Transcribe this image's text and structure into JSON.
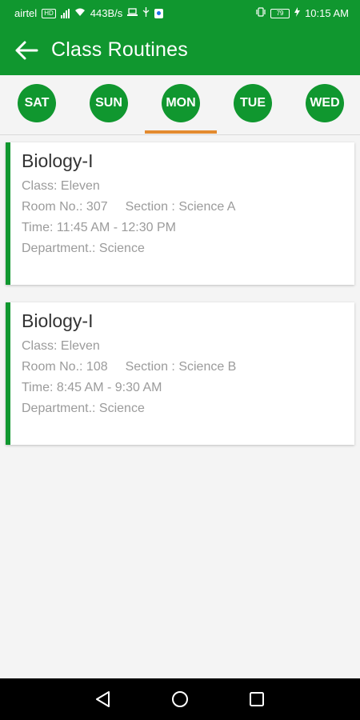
{
  "status_bar": {
    "carrier": "airtel",
    "carrier_badge": "HD",
    "speed": "443B/s",
    "battery_level": "79",
    "time": "10:15 AM"
  },
  "app_bar": {
    "title": "Class Routines"
  },
  "days": [
    {
      "label": "SAT",
      "selected": false
    },
    {
      "label": "SUN",
      "selected": false
    },
    {
      "label": "MON",
      "selected": true
    },
    {
      "label": "TUE",
      "selected": false
    },
    {
      "label": "WED",
      "selected": false
    }
  ],
  "routines": [
    {
      "subject": "Biology-I",
      "class": "Class: Eleven",
      "room": "Room No.: 307",
      "section": "Section : Science A",
      "time": "Time: 11:45 AM - 12:30 PM",
      "department": "Department.: Science"
    },
    {
      "subject": "Biology-I",
      "class": "Class: Eleven",
      "room": "Room No.: 108",
      "section": "Section : Science B",
      "time": "Time: 8:45 AM - 9:30 AM",
      "department": "Department.: Science"
    }
  ],
  "colors": {
    "primary": "#10972f",
    "indicator": "#e38a2f",
    "background": "#f4f4f4",
    "muted_text": "#9b9b9b"
  },
  "icons": {
    "back": "arrow-left-icon",
    "nav_back": "triangle-back-icon",
    "nav_home": "circle-home-icon",
    "nav_recents": "square-recents-icon"
  }
}
